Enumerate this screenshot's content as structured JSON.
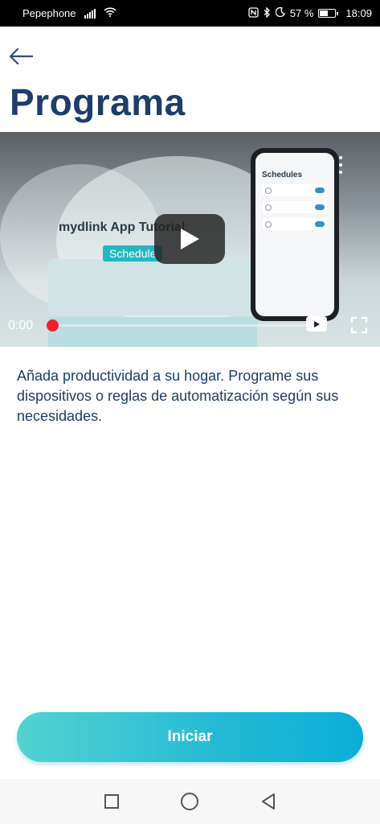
{
  "status_bar": {
    "carrier": "Pepephone",
    "battery_percent": "57 %",
    "battery_level": 0.57,
    "time": "18:09",
    "icons": [
      "signal-icon",
      "wifi-icon",
      "nfc-icon",
      "bluetooth-icon",
      "moon-icon",
      "battery-icon"
    ]
  },
  "header": {
    "back_icon": "arrow-left-icon",
    "title": "Programa"
  },
  "video": {
    "tutorial_title": "mydlink App Tutorial",
    "chip_label": "Schedule",
    "phone_screen_title": "Schedules",
    "current_time": "0:00",
    "progress": 0,
    "icons": [
      "play-icon",
      "youtube-icon",
      "fullscreen-icon",
      "more-vert-icon"
    ]
  },
  "description": "Añada productividad a su hogar. Programe sus dispositivos o reglas de automatización según sus necesidades.",
  "actions": {
    "start_label": "Iniciar"
  },
  "nav_bar": {
    "icons": [
      "recents-square-icon",
      "home-circle-icon",
      "back-triangle-icon"
    ]
  },
  "colors": {
    "title": "#1d3e6b",
    "accent_start": "#52d3d1",
    "accent_end": "#0aaed8",
    "progress_knob": "#f0202a"
  }
}
